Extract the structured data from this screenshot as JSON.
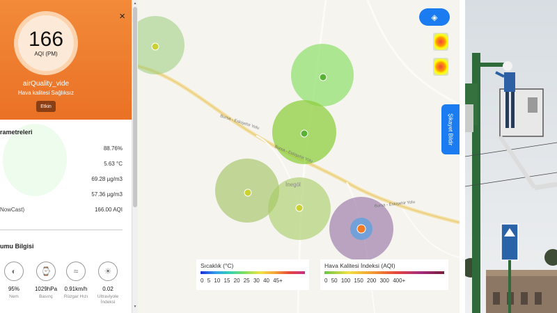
{
  "panel": {
    "aqi_value": "166",
    "aqi_unit": "AQI (PM)",
    "station_name": "airQuality_vide",
    "status_text": "Hava kalitesi Sağlıksız",
    "effect_button": "Etkin",
    "close_symbol": "×",
    "colors": {
      "accent": "#ea7125",
      "effect_button": "#8a3e14"
    },
    "params_title": "rametreleri",
    "params": [
      {
        "label": "",
        "value": "88.76%"
      },
      {
        "label": "",
        "value": "5.63 °C"
      },
      {
        "label": "",
        "value": "69.28 µg/m3"
      },
      {
        "label": "",
        "value": "57.36 µg/m3"
      },
      {
        "label": "NowCast)",
        "value": "166.00 AQI"
      }
    ],
    "weather_title": "umu Bilgisi",
    "weather": [
      {
        "icon": "humidity-icon",
        "value": "95%",
        "label": "Nem"
      },
      {
        "icon": "pressure-gauge-icon",
        "value": "1029hPa",
        "label": "Basınç"
      },
      {
        "icon": "wind-icon",
        "value": "0.91km/h",
        "label": "Rüzgar Hızı"
      },
      {
        "icon": "uv-icon",
        "value": "0.02",
        "label": "Ultraviyole İndeksi"
      }
    ]
  },
  "map": {
    "city_label": "İnegöl",
    "road_label_1": "Bursa - Eskişehir Yolu",
    "road_label_2": "Bursa - Eskişehir Yolu",
    "report_button": "Şikayet Bildir",
    "layers_icon": "layers-icon",
    "legend_temp": {
      "title": "Sıcaklık (°C)",
      "ticks": [
        "0",
        "5",
        "10",
        "15",
        "20",
        "25",
        "30",
        "40",
        "45+"
      ]
    },
    "legend_aqi": {
      "title": "Hava Kalitesi İndeksi (AQI)",
      "ticks": [
        "0",
        "50",
        "100",
        "150",
        "200",
        "300",
        "400+"
      ]
    }
  }
}
